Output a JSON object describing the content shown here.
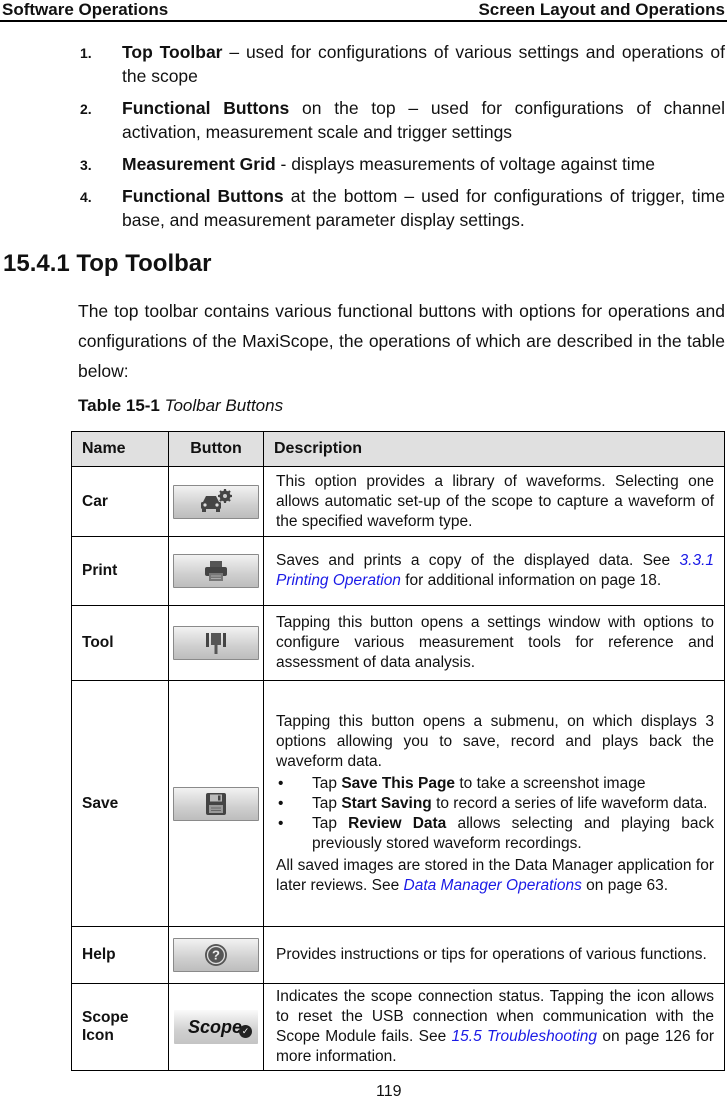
{
  "header": {
    "left": "Software Operations",
    "right": "Screen Layout and Operations"
  },
  "numbered_list": [
    {
      "num": "1.",
      "bold": "Top Toolbar",
      "text": " – used for configurations of various settings and operations of the scope"
    },
    {
      "num": "2.",
      "bold": "Functional Buttons",
      "text": " on the top – used for configurations of channel activation, measurement scale and trigger settings"
    },
    {
      "num": "3.",
      "bold": "Measurement Grid",
      "text": " - displays measurements of voltage against time"
    },
    {
      "num": "4.",
      "bold": "Functional Buttons",
      "text": " at the bottom – used for configurations of trigger, time base, and measurement parameter display settings."
    }
  ],
  "section": {
    "heading": "15.4.1 Top Toolbar",
    "paragraph": "The top toolbar contains various functional buttons with options for operations and configurations of the MaxiScope, the operations of which are described in the table below:"
  },
  "table_caption": {
    "label": "Table 15-1",
    "title": "Toolbar Buttons"
  },
  "table": {
    "headers": [
      "Name",
      "Button",
      "Description"
    ],
    "rows": [
      {
        "name": "Car",
        "icon": "car-settings-icon",
        "desc": "This option provides a library of waveforms. Selecting one allows automatic set-up of the scope to capture a waveform of the specified waveform type."
      },
      {
        "name": "Print",
        "icon": "printer-icon",
        "desc_pre": "Saves and prints a copy of the displayed data. See ",
        "link": "3.3.1 Printing Operation",
        "desc_post": " for additional information on page 18."
      },
      {
        "name": "Tool",
        "icon": "measurement-tool-icon",
        "desc": "Tapping this button opens a settings window with options to configure various measurement tools for reference and assessment of data analysis."
      },
      {
        "name": "Save",
        "icon": "floppy-disk-icon",
        "desc_intro": "Tapping this button opens a submenu, on which displays 3 options allowing you to save, record and plays back the waveform data.",
        "bullets": [
          {
            "pre": "Tap ",
            "bold": "Save This Page",
            "post": " to take a screenshot image"
          },
          {
            "pre": "Tap ",
            "bold": "Start Saving",
            "post": " to record a series of life waveform data."
          },
          {
            "pre": "Tap ",
            "bold": "Review Data",
            "post": " allows selecting and playing back previously stored waveform recordings."
          }
        ],
        "desc_outro_pre": "All saved images are stored in the Data Manager application for later reviews. See ",
        "link": "Data Manager Operations",
        "desc_outro_post": " on page 63."
      },
      {
        "name": "Help",
        "icon": "help-question-icon",
        "desc": "Provides instructions or tips for operations of various functions."
      },
      {
        "name": "Scope Icon",
        "icon": "scope-status-icon",
        "icon_text": "Scope",
        "desc_pre": "Indicates the scope connection status. Tapping the icon allows to reset the USB connection when communication with the Scope Module fails. See ",
        "link": "15.5 Troubleshooting",
        "desc_post": " on page 126 for more information."
      }
    ]
  },
  "page_number": "119"
}
